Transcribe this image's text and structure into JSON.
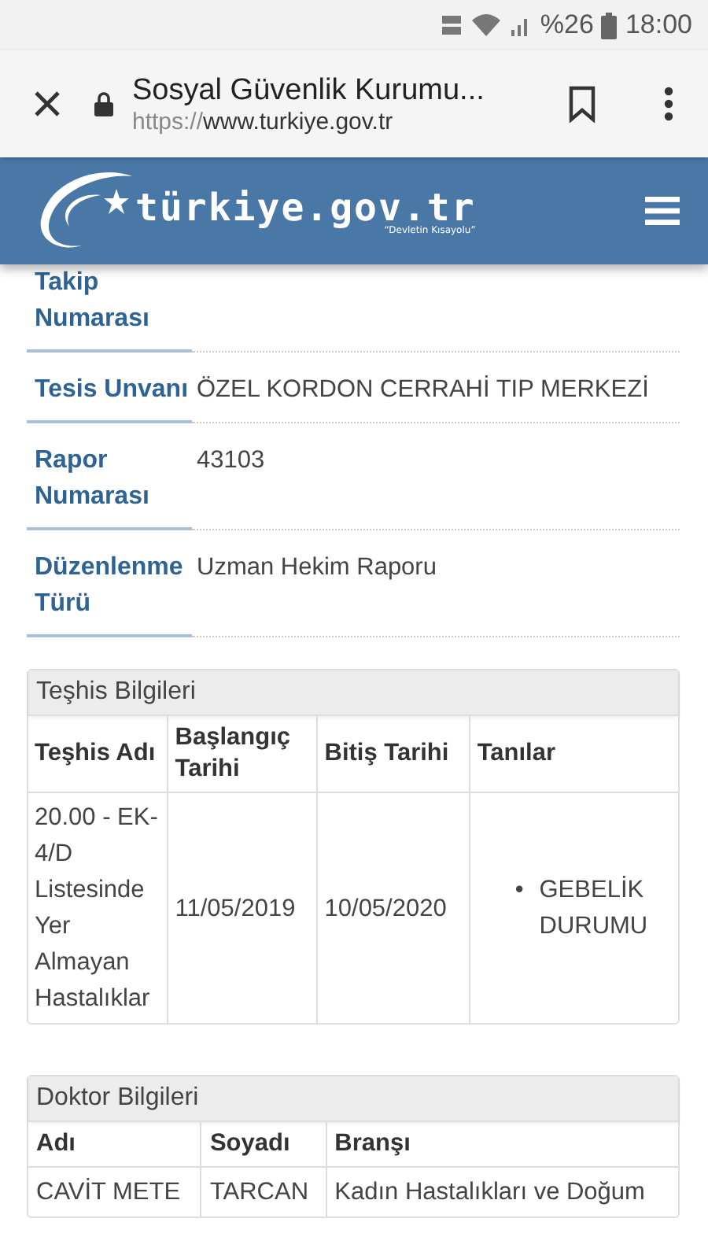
{
  "status_bar": {
    "battery": "%26",
    "time": "18:00"
  },
  "browser": {
    "title": "Sosyal Güvenlik Kurumu...",
    "url_scheme": "https://",
    "url_host": "www.turkiye.gov.tr"
  },
  "site_header": {
    "logo_text": "türkiye.gov.tr",
    "logo_tagline": "“Devletin Kısayolu”"
  },
  "details": [
    {
      "label": "Takip Numarası"
    },
    {
      "label": "Tesis Unvanı",
      "value": "ÖZEL KORDON CERRAHİ TIP MERKEZİ"
    },
    {
      "label": "Rapor Numarası",
      "value": "43103"
    },
    {
      "label": "Düzenlenme Türü",
      "value": "Uzman Hekim Raporu"
    }
  ],
  "diagnosis": {
    "title": "Teşhis Bilgileri",
    "columns": [
      "Teşhis Adı",
      "Başlangıç Tarihi",
      "Bitiş Tarihi",
      "Tanılar"
    ],
    "rows": [
      {
        "name": "20.00 - EK-4/D Listesinde Yer Almayan Hastalıklar",
        "start": "11/05/2019",
        "end": "10/05/2020",
        "diagnoses": [
          {
            "marker": "•",
            "text": "GEBELİK DURUMU"
          }
        ]
      }
    ]
  },
  "doctor": {
    "title": "Doktor Bilgileri",
    "columns": [
      "Adı",
      "Soyadı",
      "Branşı"
    ],
    "rows": [
      [
        "CAVİT METE",
        "TARCAN",
        "Kadın Hastalıkları ve Doğum"
      ]
    ]
  }
}
